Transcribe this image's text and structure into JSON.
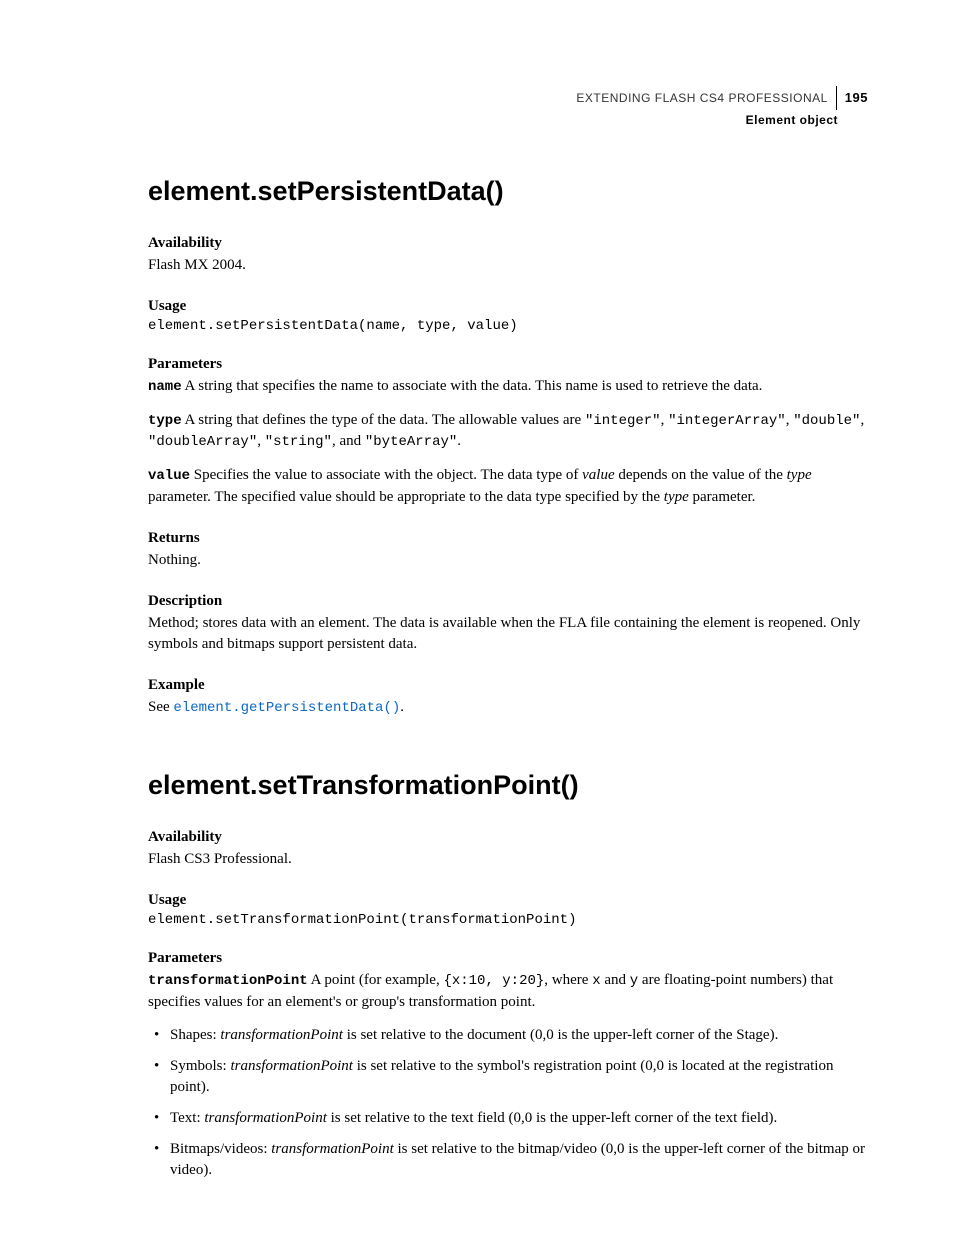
{
  "header": {
    "title": "EXTENDING FLASH CS4 PROFESSIONAL",
    "pagenum": "195",
    "crumb": "Element object"
  },
  "s1": {
    "heading": "element.setPersistentData()",
    "availability_h": "Availability",
    "availability": "Flash MX 2004.",
    "usage_h": "Usage",
    "usage_code": "element.setPersistentData(name, type, value)",
    "parameters_h": "Parameters",
    "param_name_code": "name",
    "param_name_text": "  A string that specifies the name to associate with the data. This name is used to retrieve the data.",
    "param_type_code": "type",
    "param_type_pre": "  A string that defines the type of the data. The allowable values are ",
    "param_type_v1": "\"integer\"",
    "param_type_v2": "\"integerArray\"",
    "param_type_v3": "\"double\"",
    "param_type_v4": "\"doubleArray\"",
    "param_type_v5": "\"string\"",
    "param_type_and": ", and ",
    "param_type_v6": "\"byteArray\"",
    "param_value_code": "value",
    "param_value_pre": "  Specifies the value to associate with the object. The data type of ",
    "param_value_em1": "value",
    "param_value_mid": " depends on the value of the ",
    "param_value_em2": "type",
    "param_value_post": " parameter. The specified value should be appropriate to the data type specified by the ",
    "param_value_em3": "type",
    "param_value_end": " parameter.",
    "returns_h": "Returns",
    "returns": "Nothing.",
    "description_h": "Description",
    "description": "Method; stores data with an element. The data is available when the FLA file containing the element is reopened. Only symbols and bitmaps support persistent data.",
    "example_h": "Example",
    "example_pre": "See ",
    "example_link": "element.getPersistentData()",
    "example_post": "."
  },
  "s2": {
    "heading": "element.setTransformationPoint()",
    "availability_h": "Availability",
    "availability": "Flash CS3 Professional.",
    "usage_h": "Usage",
    "usage_code": "element.setTransformationPoint(transformationPoint)",
    "parameters_h": "Parameters",
    "param_tp_code": "transformationPoint",
    "param_tp_pre": "  A point (for example, ",
    "param_tp_ex": "{x:10, y:20}",
    "param_tp_mid1": ", where ",
    "param_tp_x": "x",
    "param_tp_mid2": " and ",
    "param_tp_y": "y",
    "param_tp_post": " are floating-point numbers) that specifies values for an element's or group's transformation point.",
    "b1_pre": "Shapes: ",
    "b1_em": "transformationPoint",
    "b1_post": " is set relative to the document (0,0 is the upper-left corner of the Stage).",
    "b2_pre": "Symbols: ",
    "b2_em": "transformationPoint",
    "b2_post": " is set relative to the symbol's registration point (0,0 is located at the registration point).",
    "b3_pre": "Text: ",
    "b3_em": "transformationPoint",
    "b3_post": " is set relative to the text field (0,0 is the upper-left corner of the text field).",
    "b4_pre": "Bitmaps/videos: ",
    "b4_em": "transformationPoint",
    "b4_post": " is set relative to the bitmap/video (0,0 is the upper-left corner of the bitmap or video)."
  }
}
